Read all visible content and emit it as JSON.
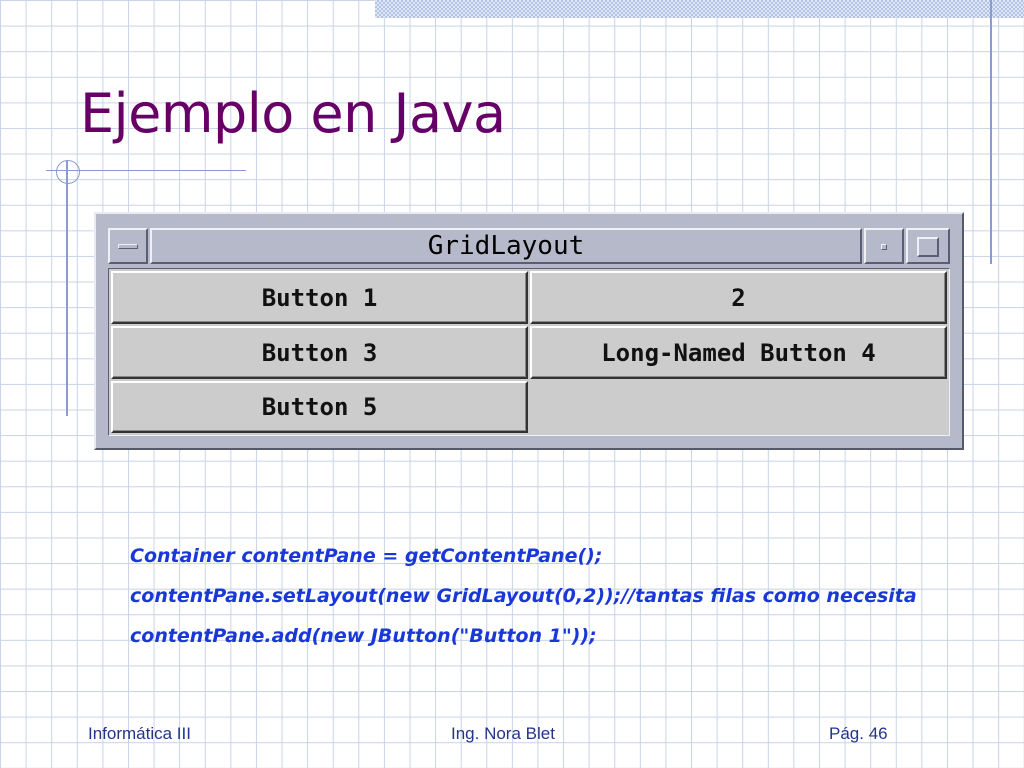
{
  "slide": {
    "title": "Ejemplo en Java"
  },
  "window": {
    "title": "GridLayout",
    "buttons": [
      {
        "label": "Button 1"
      },
      {
        "label": "2"
      },
      {
        "label": "Button 3"
      },
      {
        "label": "Long-Named Button 4"
      },
      {
        "label": "Button 5"
      }
    ]
  },
  "code": {
    "lines": [
      "Container contentPane = getContentPane();",
      "contentPane.setLayout(new GridLayout(0,2));//tantas filas como necesita",
      "contentPane.add(new JButton(\"Button 1\"));"
    ]
  },
  "footer": {
    "left": "Informática III",
    "center": "Ing. Nora Blet",
    "right": "Pág. 46"
  },
  "colors": {
    "title": "#660066",
    "code": "#1a38d8",
    "footer": "#23348a",
    "grid": "#c9d3e6",
    "accent_lines": "#8a9bd0"
  }
}
